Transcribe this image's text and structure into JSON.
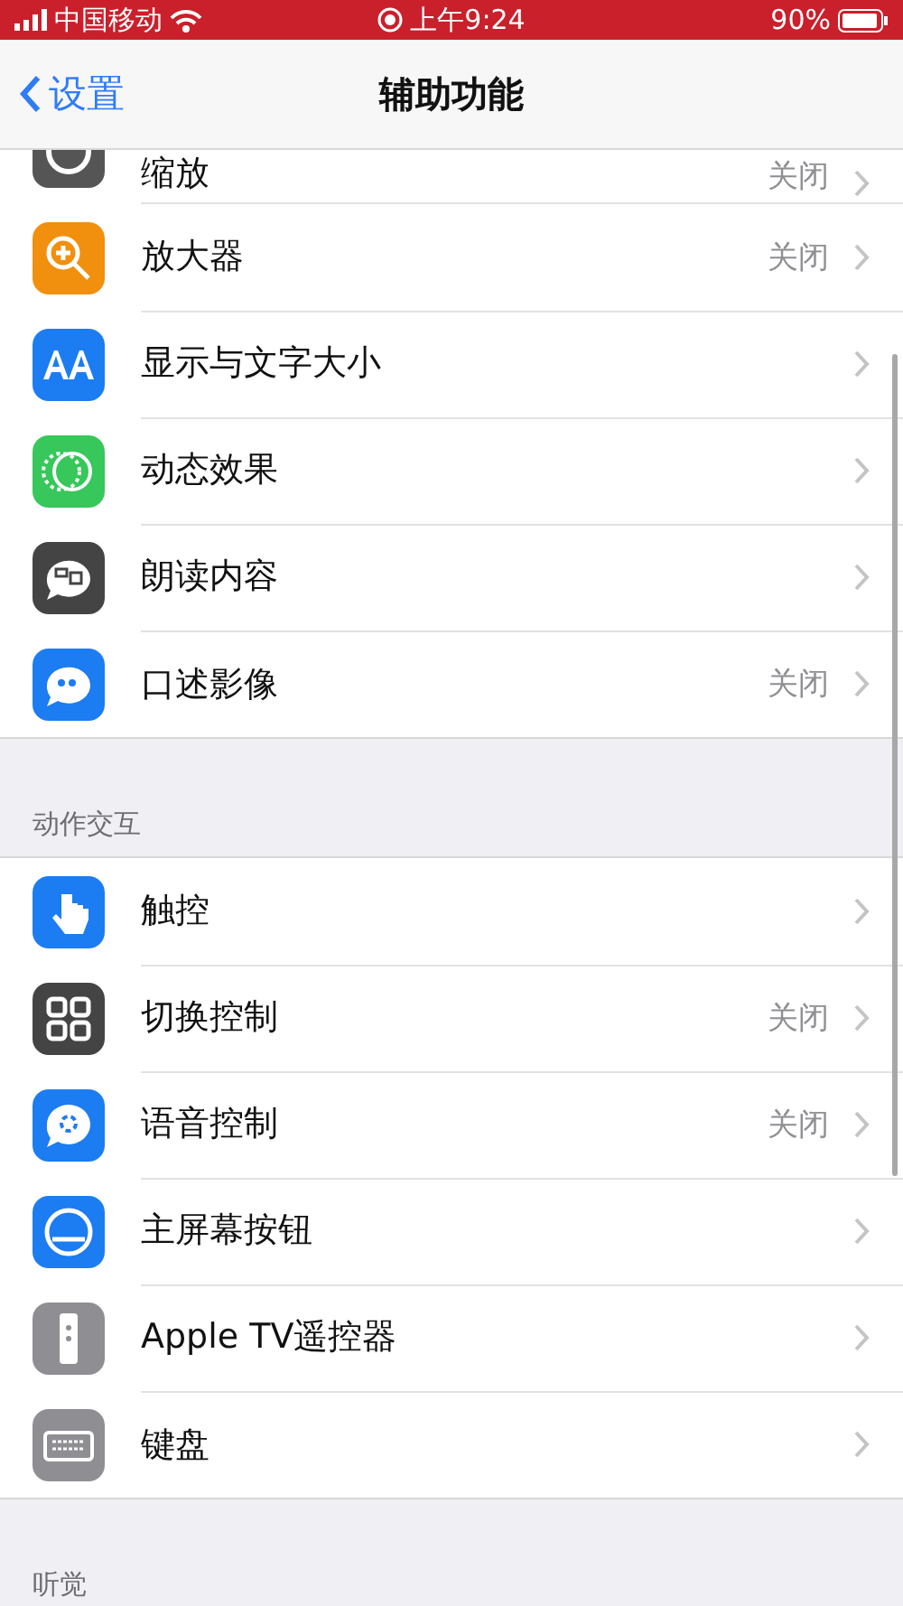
{
  "status_bar": {
    "carrier": "中国移动",
    "time": "上午9:24",
    "battery": "90%"
  },
  "nav": {
    "back": "设置",
    "title": "辅助功能"
  },
  "sections": [
    {
      "items": [
        {
          "label": "缩放",
          "value": "关闭"
        },
        {
          "label": "放大器",
          "value": "关闭"
        },
        {
          "label": "显示与文字大小"
        },
        {
          "label": "动态效果"
        },
        {
          "label": "朗读内容"
        },
        {
          "label": "口述影像",
          "value": "关闭"
        }
      ]
    },
    {
      "header": "动作交互",
      "items": [
        {
          "label": "触控"
        },
        {
          "label": "切换控制",
          "value": "关闭"
        },
        {
          "label": "语音控制",
          "value": "关闭"
        },
        {
          "label": "主屏幕按钮"
        },
        {
          "label": "Apple TV遥控器"
        },
        {
          "label": "键盘"
        }
      ]
    },
    {
      "header": "听觉"
    }
  ]
}
